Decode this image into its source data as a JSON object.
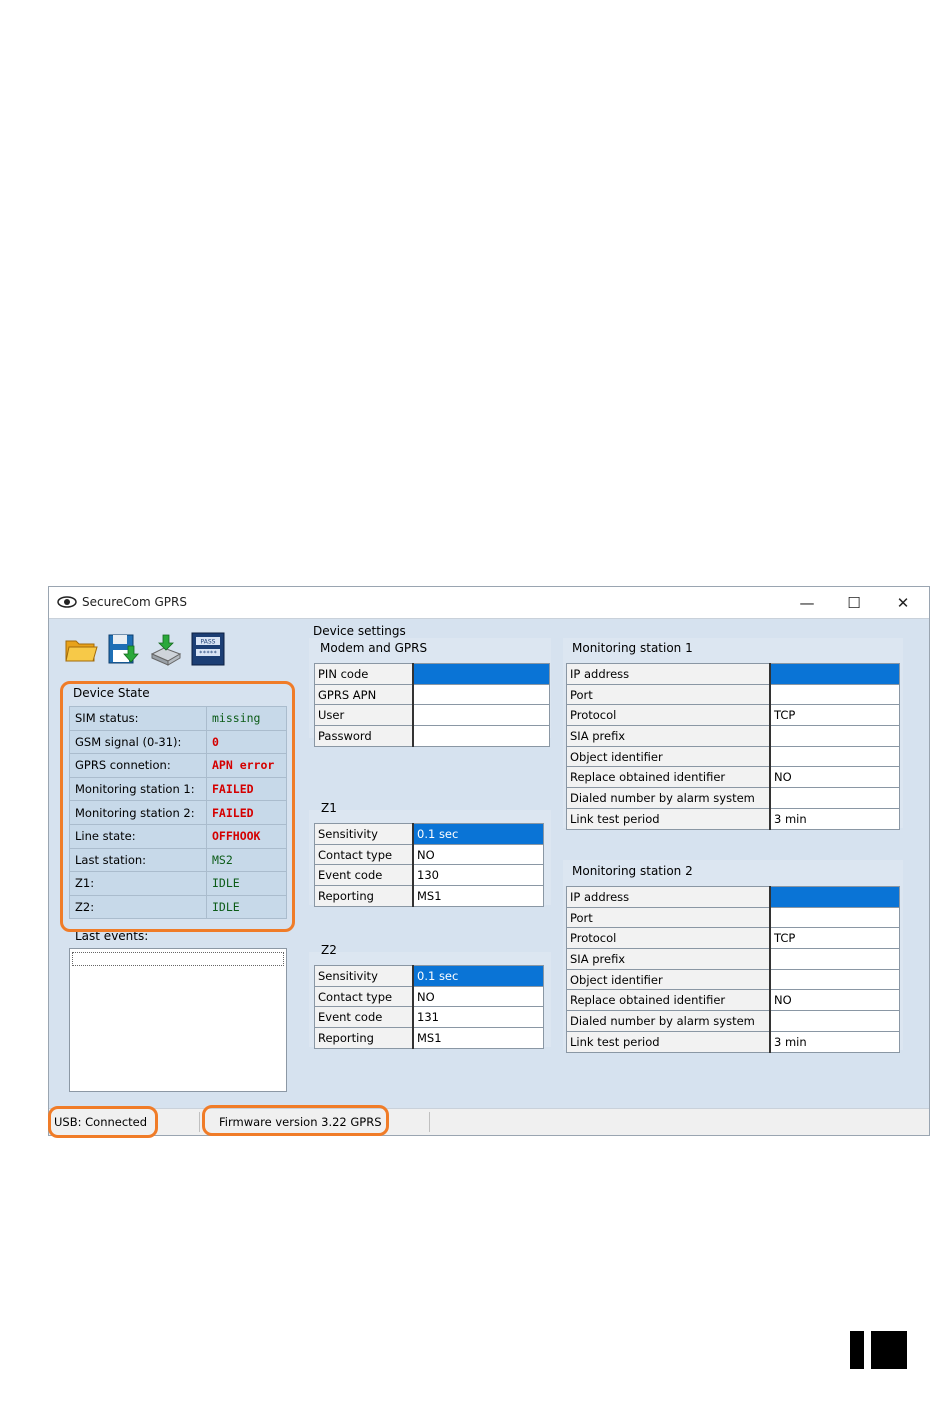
{
  "window": {
    "title": "SecureCom GPRS",
    "minimize": "—",
    "maximize": "☐",
    "close": "✕"
  },
  "toolbar": {
    "open_icon": "folder-open-icon",
    "save_icon": "floppy-save-icon",
    "write_icon": "device-write-icon",
    "password_icon": "pass-icon",
    "password_text": "PASS"
  },
  "device_state": {
    "title": "Device State",
    "rows": [
      {
        "label": "SIM status:",
        "value": "missing",
        "status": "ok"
      },
      {
        "label": "GSM signal (0-31):",
        "value": "0",
        "status": "error"
      },
      {
        "label": "GPRS connetion:",
        "value": "APN error",
        "status": "error"
      },
      {
        "label": "Monitoring station 1:",
        "value": "FAILED",
        "status": "error"
      },
      {
        "label": "Monitoring station 2:",
        "value": "FAILED",
        "status": "error"
      },
      {
        "label": "Line state:",
        "value": "OFFHOOK",
        "status": "error"
      },
      {
        "label": "Last station:",
        "value": "MS2",
        "status": "ok"
      },
      {
        "label": "Z1:",
        "value": "IDLE",
        "status": "ok"
      },
      {
        "label": "Z2:",
        "value": "IDLE",
        "status": "ok"
      }
    ]
  },
  "last_events": {
    "title": "Last events:"
  },
  "device_settings": {
    "title": "Device settings",
    "modem": {
      "title": "Modem and GPRS",
      "rows": [
        {
          "label": "PIN code",
          "value": ""
        },
        {
          "label": "GPRS APN",
          "value": ""
        },
        {
          "label": "User",
          "value": ""
        },
        {
          "label": "Password",
          "value": ""
        }
      ]
    },
    "z1": {
      "title": "Z1",
      "rows": [
        {
          "label": "Sensitivity",
          "value": "0.1 sec"
        },
        {
          "label": "Contact type",
          "value": "NO"
        },
        {
          "label": "Event code",
          "value": "130"
        },
        {
          "label": "Reporting",
          "value": "MS1"
        }
      ]
    },
    "z2": {
      "title": "Z2",
      "rows": [
        {
          "label": "Sensitivity",
          "value": "0.1 sec"
        },
        {
          "label": "Contact type",
          "value": "NO"
        },
        {
          "label": "Event code",
          "value": "131"
        },
        {
          "label": "Reporting",
          "value": "MS1"
        }
      ]
    },
    "ms1": {
      "title": "Monitoring station 1",
      "rows": [
        {
          "label": "IP address",
          "value": ""
        },
        {
          "label": "Port",
          "value": ""
        },
        {
          "label": "Protocol",
          "value": "TCP"
        },
        {
          "label": "SIA prefix",
          "value": ""
        },
        {
          "label": "Object identifier",
          "value": ""
        },
        {
          "label": "Replace obtained identifier",
          "value": "NO"
        },
        {
          "label": "Dialed number by alarm system",
          "value": ""
        },
        {
          "label": "Link test period",
          "value": "3 min"
        }
      ]
    },
    "ms2": {
      "title": "Monitoring station 2",
      "rows": [
        {
          "label": "IP address",
          "value": ""
        },
        {
          "label": "Port",
          "value": ""
        },
        {
          "label": "Protocol",
          "value": "TCP"
        },
        {
          "label": "SIA prefix",
          "value": ""
        },
        {
          "label": "Object identifier",
          "value": ""
        },
        {
          "label": "Replace obtained identifier",
          "value": "NO"
        },
        {
          "label": "Dialed number by alarm system",
          "value": ""
        },
        {
          "label": "Link test period",
          "value": "3 min"
        }
      ]
    }
  },
  "statusbar": {
    "usb": "USB: Connected",
    "firmware": "Firmware version 3.22 GPRS"
  },
  "colors": {
    "highlight": "#f07c28",
    "selection": "#0a74d6",
    "error_text": "#d40000",
    "ok_text": "#0b5b17"
  }
}
